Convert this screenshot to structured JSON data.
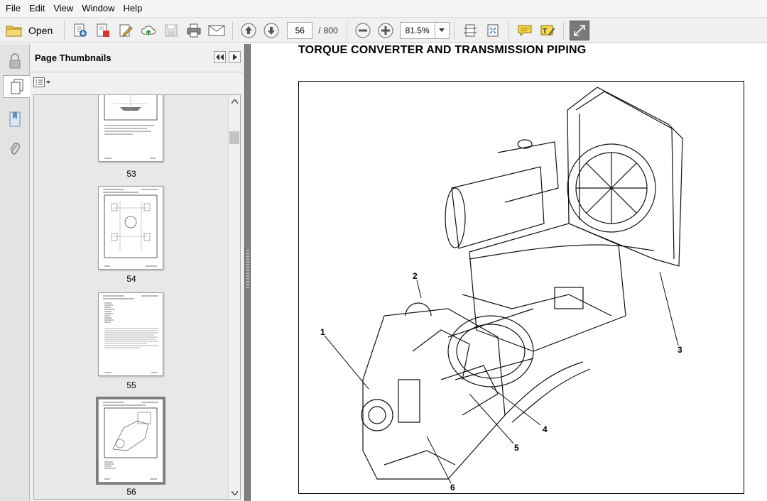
{
  "menu": [
    "File",
    "Edit",
    "View",
    "Window",
    "Help"
  ],
  "toolbar": {
    "open_label": "Open",
    "current_page": "56",
    "page_separator": "/",
    "total_pages": "800",
    "zoom": "81.5%"
  },
  "thumbnails": {
    "title": "Page Thumbnails",
    "items": [
      {
        "label": "53"
      },
      {
        "label": "54"
      },
      {
        "label": "55"
      },
      {
        "label": "56",
        "selected": true
      }
    ]
  },
  "document": {
    "title": "TORQUE CONVERTER AND TRANSMISSION PIPING",
    "callouts": [
      "1",
      "2",
      "3",
      "4",
      "5",
      "6"
    ]
  },
  "colors": {
    "toolbar_bg": "#f0f0f0",
    "panel_bg": "#f0f0f0",
    "splitter": "#7f7f7f",
    "icon_blue": "#2f6fb5",
    "icon_yellow": "#f2c200"
  }
}
